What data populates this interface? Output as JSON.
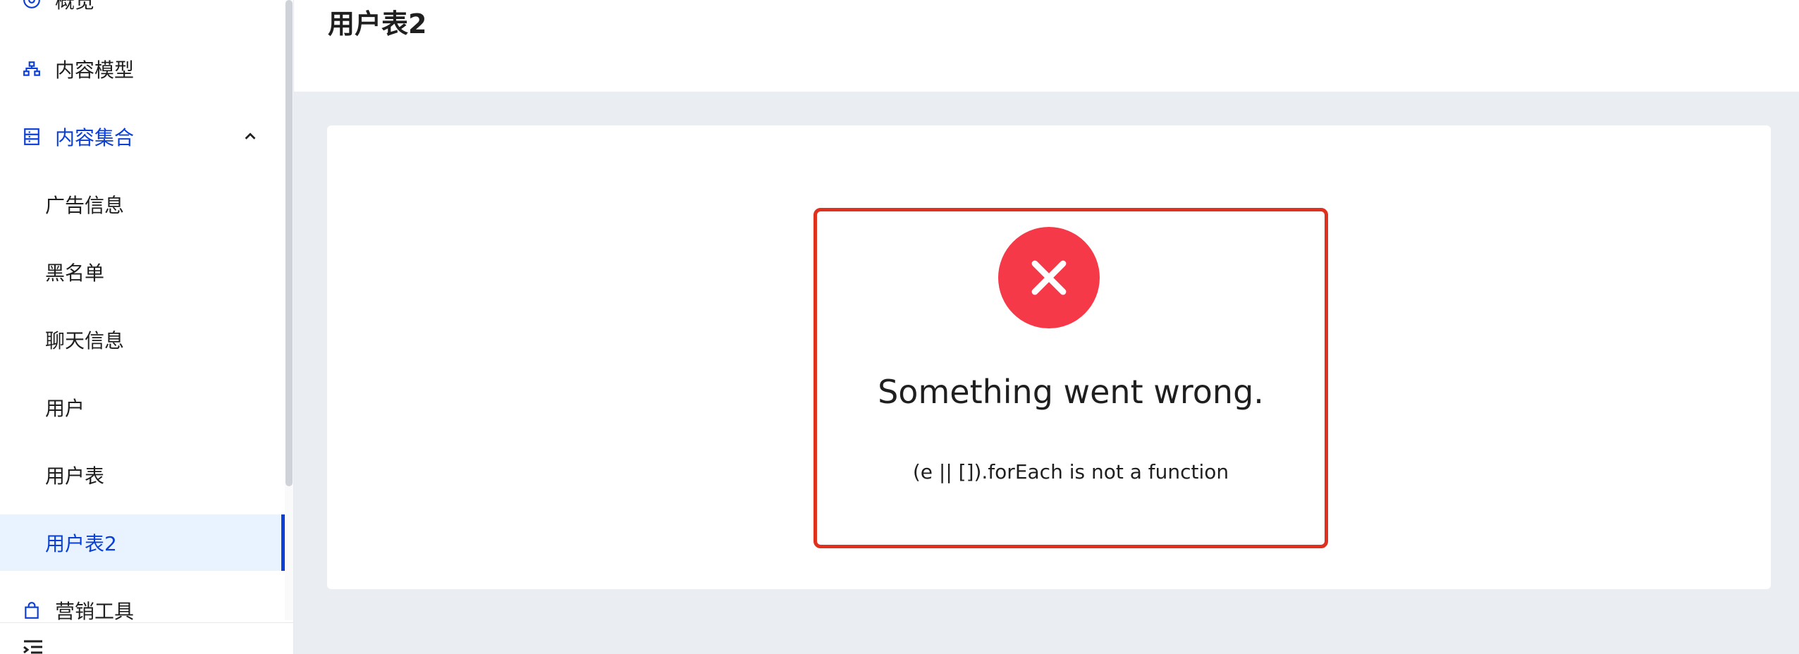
{
  "page": {
    "title": "用户表2"
  },
  "sidebar": {
    "items": [
      {
        "label": "概览",
        "icon": "eye-icon"
      },
      {
        "label": "内容模型",
        "icon": "sitemap-icon"
      },
      {
        "label": "内容集合",
        "icon": "list-icon",
        "expanded": true,
        "children": [
          {
            "label": "广告信息"
          },
          {
            "label": "黑名单"
          },
          {
            "label": "聊天信息"
          },
          {
            "label": "用户"
          },
          {
            "label": "用户表"
          },
          {
            "label": "用户表2",
            "active": true
          }
        ]
      },
      {
        "label": "营销工具",
        "icon": "shopping-bag-icon"
      }
    ]
  },
  "error": {
    "title": "Something went wrong.",
    "message": "(e || []).forEach is not a function"
  },
  "colors": {
    "accent": "#0b3fd6",
    "active_bg": "#e8f3ff",
    "error_red": "#f53948",
    "error_border": "#e0301e",
    "content_bg": "#eaeef2"
  }
}
